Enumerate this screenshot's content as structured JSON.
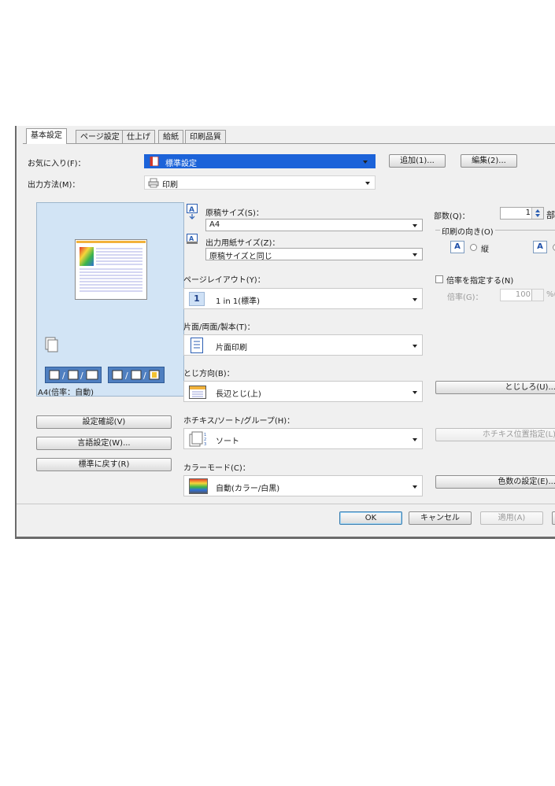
{
  "tabs": [
    "基本設定",
    "ページ設定",
    "仕上げ",
    "給紙",
    "印刷品質"
  ],
  "favorites": {
    "label": "お気に入り(F)：",
    "value": "標準設定",
    "add_button": "追加(1)...",
    "edit_button": "編集(2)..."
  },
  "output": {
    "label": "出力方法(M)：",
    "value": "印刷"
  },
  "preview": {
    "caption": "A4(倍率：自動)"
  },
  "left_buttons": {
    "confirm": "設定確認(V)",
    "language": "言語設定(W)...",
    "restore": "標準に戻す(R)"
  },
  "original_size": {
    "label": "原稿サイズ(S)：",
    "value": "A4"
  },
  "output_size": {
    "label": "出力用紙サイズ(Z)：",
    "value": "原稿サイズと同じ"
  },
  "page_layout": {
    "label": "ページレイアウト(Y)：",
    "value": "1 in 1(標準)",
    "icon_text": "1"
  },
  "duplex": {
    "label": "片面/両面/製本(T)：",
    "value": "片面印刷"
  },
  "binding": {
    "label": "とじ方向(B)：",
    "value": "長辺とじ(上)"
  },
  "stapler": {
    "label": "ホチキス/ソート/グループ(H)：",
    "value": "ソート"
  },
  "color_mode": {
    "label": "カラーモード(C)：",
    "value": "自動(カラー/白黒)"
  },
  "copies": {
    "label": "部数(Q)：",
    "value": "1",
    "unit": "部"
  },
  "orientation": {
    "label": "印刷の向き(O)",
    "portrait": "縦",
    "glyph": "A"
  },
  "scale": {
    "checkbox_label": "倍率を指定する(N)",
    "label": "倍率(G)：",
    "value": "100",
    "unit": "%("
  },
  "right_buttons": {
    "margin": "とじしろ(U)...",
    "staple_pos": "ホチキス位置指定(L)",
    "color_count": "色数の設定(E)..."
  },
  "footer": {
    "ok": "OK",
    "cancel": "キャンセル",
    "apply": "適用(A)"
  }
}
